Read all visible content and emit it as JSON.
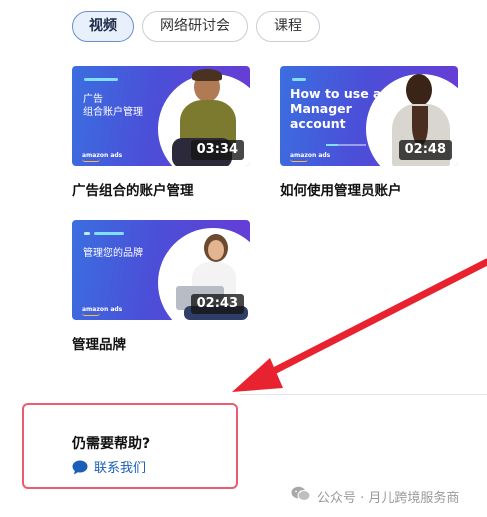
{
  "tabs": [
    {
      "label": "视频",
      "active": true
    },
    {
      "label": "网络研讨会",
      "active": false
    },
    {
      "label": "课程",
      "active": false
    }
  ],
  "videos": [
    {
      "overlay_line1": "广告",
      "overlay_line2": "组合账户管理",
      "duration": "03:34",
      "title": "广告组合的账户管理",
      "logo": "amazon ads"
    },
    {
      "overlay_line1": "How to use a",
      "overlay_line2": "Manager",
      "overlay_line3": "account",
      "duration": "02:48",
      "title": "如何使用管理员账户",
      "logo": "amazon ads"
    },
    {
      "overlay_line1": "管理您的品牌",
      "duration": "02:43",
      "title": "管理品牌",
      "logo": "amazon ads"
    }
  ],
  "help": {
    "title": "仍需要帮助?",
    "contact_label": "联系我们",
    "contact_icon": "chat-bubble-icon"
  },
  "watermark": {
    "text": "公众号 · 月儿跨境服务商",
    "icon": "wechat-icon"
  },
  "colors": {
    "accent_link": "#1c5db8",
    "highlight_border": "#ef5b6e",
    "arrow": "#e8232f",
    "thumb_gradient_start": "#3b6fe0",
    "thumb_gradient_end": "#6a3ad6"
  }
}
